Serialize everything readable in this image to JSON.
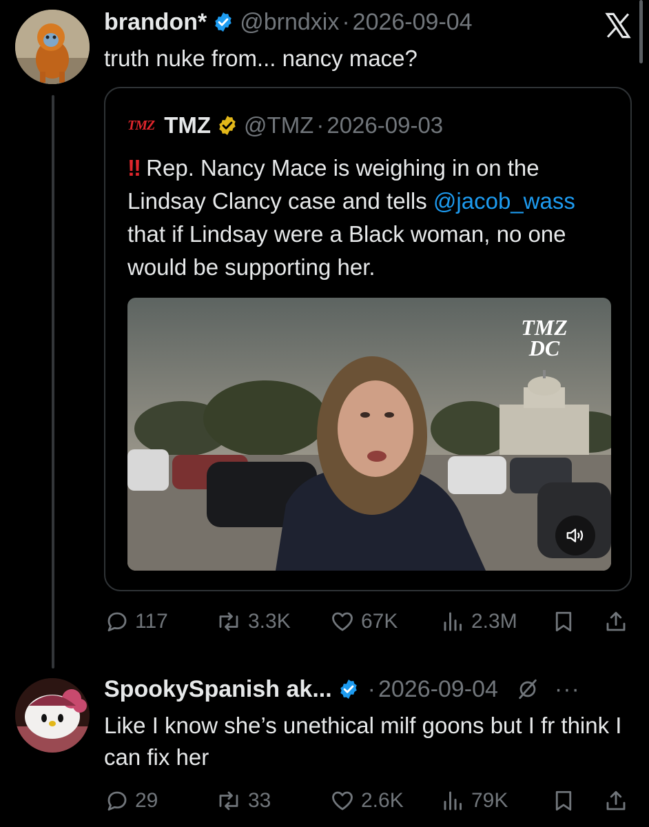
{
  "tweet1": {
    "display_name": "brandon*",
    "handle": "@brndxix",
    "separator": "·",
    "date": "2026-09-04",
    "text": "truth nuke from... nancy mace?",
    "stats": {
      "replies": "117",
      "reposts": "3.3K",
      "likes": "67K",
      "views": "2.3M"
    }
  },
  "quote": {
    "logo_text": "TMZ",
    "display_name": "TMZ",
    "handle": "@TMZ",
    "separator": "·",
    "date": "2026-09-03",
    "emoji": "!!",
    "text_part1": "Rep. Nancy Mace is weighing in on the Lindsay Clancy case and tells ",
    "mention": "@jacob_wass",
    "text_part2": " that if Lindsay were a Black woman, no one would be supporting her.",
    "video_watermark_line1": "TMZ",
    "video_watermark_line2": "DC"
  },
  "tweet2": {
    "display_name": "SpookySpanish ak...",
    "separator": "·",
    "date": "2026-09-04",
    "more": "···",
    "text": "Like I know she’s unethical milf goons but I fr think I can fix her",
    "stats": {
      "replies": "29",
      "reposts": "33",
      "likes": "2.6K",
      "views": "79K"
    }
  },
  "icons": {
    "verified_blue": "#1d9bf0",
    "verified_gold": "#e2b719",
    "app_logo": "x-logo-icon",
    "sound": "speaker-icon"
  },
  "colors": {
    "background": "#000000",
    "text": "#e7e9ea",
    "muted": "#71767b",
    "link": "#1d9bf0",
    "brand_red": "#e0262c"
  }
}
